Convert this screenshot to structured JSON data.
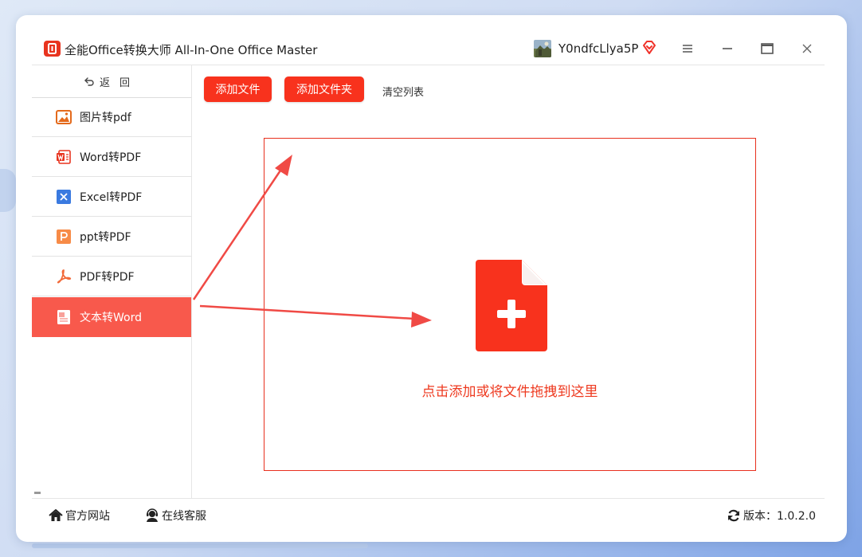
{
  "app": {
    "title": "全能Office转换大师 All-In-One Office Master",
    "username": "Y0ndfcLlya5P"
  },
  "sidebar": {
    "back_label": "返回",
    "items": [
      {
        "label": "图片转pdf",
        "icon": "image-icon"
      },
      {
        "label": "Word转PDF",
        "icon": "word-icon"
      },
      {
        "label": "Excel转PDF",
        "icon": "excel-icon"
      },
      {
        "label": "ppt转PDF",
        "icon": "ppt-icon"
      },
      {
        "label": "PDF转PDF",
        "icon": "pdf-icon"
      },
      {
        "label": "文本转Word",
        "icon": "text-doc-icon",
        "active": true
      }
    ]
  },
  "toolbar": {
    "add_file_label": "添加文件",
    "add_folder_label": "添加文件夹",
    "clear_list_label": "清空列表"
  },
  "drop_zone": {
    "hint": "点击添加或将文件拖拽到这里"
  },
  "statusbar": {
    "website_label": "官方网站",
    "support_label": "在线客服",
    "version_label": "版本：1.0.2.0"
  },
  "colors": {
    "accent": "#f8321d",
    "active_nav": "#f8594c",
    "drop_border": "#e8301e",
    "hint_text": "#ee3a20"
  }
}
